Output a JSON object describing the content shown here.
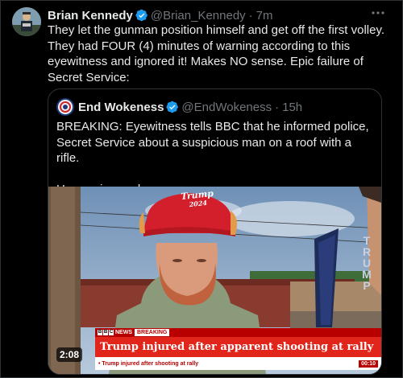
{
  "tweet": {
    "author_name": "Brian Kennedy",
    "author_handle": "@Brian_Kennedy",
    "separator": "·",
    "time": "7m",
    "text": "They let the gunman position himself and get off the first volley.\nThey had FOUR (4) minutes of warning according to this\neyewitness and ignored it!  Makes NO sense.  Epic failure of\nSecret Service:"
  },
  "quoted_tweet": {
    "author_name": "End Wokeness",
    "author_handle": "@EndWokeness",
    "separator": "·",
    "time": "15h",
    "text": "BREAKING: Eyewitness tells BBC that he informed police,\nSecret Service about a suspicious man on a roof with a rifle.\n\nHe was ignored."
  },
  "video": {
    "duration": "2:08",
    "cap_text_line1": "Trump",
    "cap_text_line2": "2024",
    "sign_text": "T\nR\nU\nM\nP",
    "bbc_letters": [
      "B",
      "B",
      "C"
    ],
    "bbc_news_label": "NEWS",
    "breaking_label": "BREAKING",
    "headline": "Trump injured after apparent shooting at rally",
    "ticker_text": "• Trump injured after shooting at rally",
    "ticker_time": "00:10"
  },
  "colors": {
    "background": "#000000",
    "text_primary": "#e7e9ea",
    "text_muted": "#71767b",
    "verified_blue": "#1d9bf0",
    "border": "#2f3336",
    "bbc_red": "#b80000",
    "headline_red": "#e1251b"
  },
  "icons": {
    "verified": "verified-badge-icon",
    "more": "more-options-icon"
  }
}
